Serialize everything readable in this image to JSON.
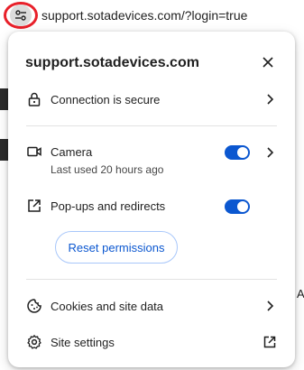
{
  "address_bar": {
    "url": "support.sotadevices.com/?login=true",
    "site_info_icon": "tune-icon"
  },
  "popup": {
    "title": "support.sotadevices.com",
    "close_icon": "close-icon",
    "connection": {
      "label": "Connection is secure",
      "icon": "lock-icon"
    },
    "camera": {
      "label": "Camera",
      "sub": "Last used 20 hours ago",
      "icon": "videocam-icon",
      "enabled": true
    },
    "popups": {
      "label": "Pop-ups and redirects",
      "icon": "open-in-new-icon",
      "enabled": true
    },
    "reset_button": "Reset permissions",
    "cookies": {
      "label": "Cookies and site data",
      "icon": "cookie-icon"
    },
    "site_settings": {
      "label": "Site settings",
      "icon": "gear-icon"
    }
  },
  "colors": {
    "accent": "#0b57d0",
    "highlight_ring": "#e8202a"
  },
  "background": {
    "edge_letter": "A"
  }
}
